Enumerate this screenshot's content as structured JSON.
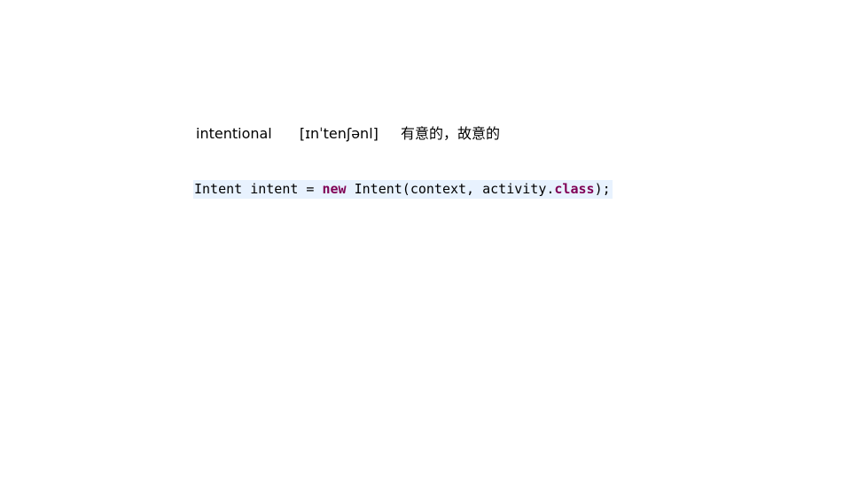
{
  "vocab": {
    "word": "intentional",
    "phonetic": "[ɪnˈtenʃənl]",
    "meaning": "有意的，故意的"
  },
  "code": {
    "part1": "Intent intent = ",
    "kw_new": "new",
    "part2": " Intent(context, activity.",
    "kw_class": "class",
    "part3": ");"
  },
  "colors": {
    "keyword": "#7f0055",
    "code_background": "#e8f2fe",
    "text": "#000000"
  }
}
